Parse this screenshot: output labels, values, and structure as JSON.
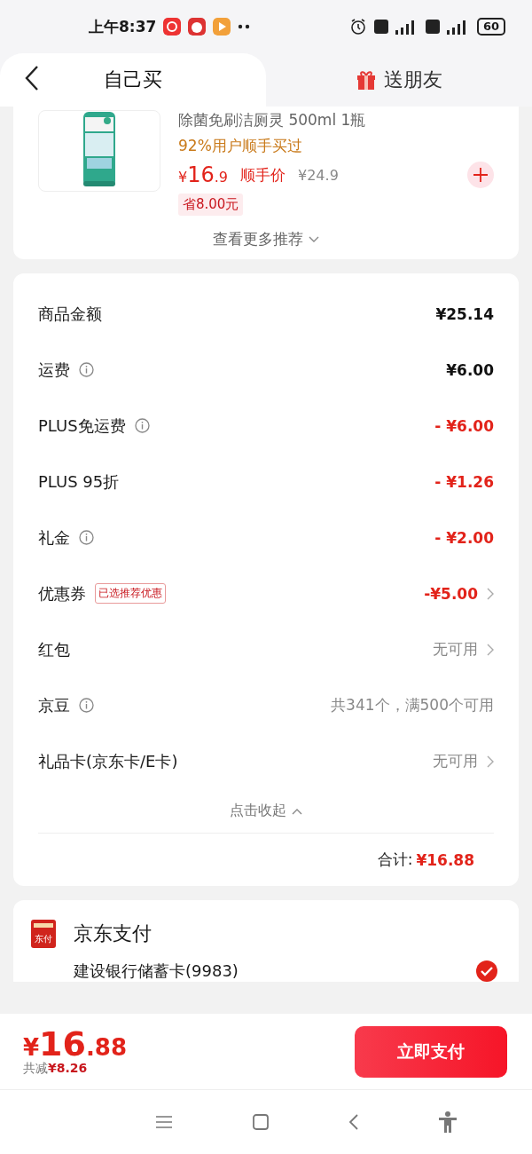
{
  "status_bar": {
    "time": "上午8:37",
    "battery": "60"
  },
  "header": {
    "tabs": [
      {
        "label": "自己买",
        "selected": true
      },
      {
        "label": "送朋友",
        "selected": false
      }
    ]
  },
  "product": {
    "name": "除菌免刷洁厕灵 500ml 1瓶",
    "tag": "92%用户顺手买过",
    "price": {
      "currency": "¥",
      "integer": "16",
      "decimal": ".9"
    },
    "price_label": "顺手价",
    "original_price": "¥24.9",
    "saving": "省8.00元",
    "more_link": "查看更多推荐"
  },
  "summary": {
    "rows": [
      {
        "label": "商品金额",
        "kind": "amount",
        "info": false,
        "value": "¥25.14"
      },
      {
        "label": "运费",
        "kind": "amount",
        "info": true,
        "value": "¥6.00"
      },
      {
        "label": "PLUS免运费",
        "kind": "discount",
        "info": true,
        "value": "- ¥6.00"
      },
      {
        "label": "PLUS 95折",
        "kind": "discount",
        "info": false,
        "value": "- ¥1.26"
      },
      {
        "label": "礼金",
        "kind": "discount",
        "info": true,
        "value": "- ¥2.00"
      },
      {
        "label": "优惠券",
        "kind": "discount-link",
        "info": false,
        "badge": "已选推荐优惠",
        "value": "-¥5.00"
      },
      {
        "label": "红包",
        "kind": "link",
        "info": false,
        "value": "无可用"
      },
      {
        "label": "京豆",
        "kind": "note",
        "info": true,
        "value": "共341个，满500个可用"
      },
      {
        "label": "礼品卡(京东卡/E卡)",
        "kind": "link",
        "info": false,
        "value": "无可用"
      }
    ],
    "collapse": "点击收起",
    "total_label": "合计:",
    "total": "¥16.88"
  },
  "payment": {
    "title": "京东支付",
    "icon_text": "东付",
    "method": "建设银行储蓄卡(9983)",
    "checked": true
  },
  "bottom_bar": {
    "price": {
      "currency": "¥",
      "integer": "16",
      "decimal": ".88"
    },
    "saved_label": "共减",
    "saved": "¥8.26",
    "pay_button": "立即支付"
  }
}
